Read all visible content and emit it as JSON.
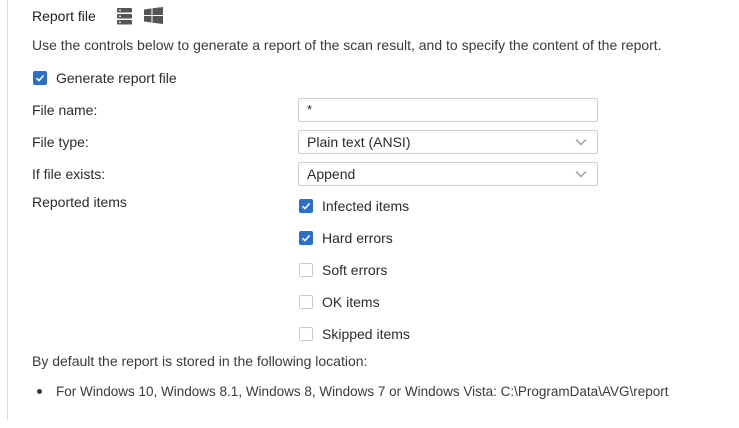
{
  "section": {
    "title": "Report file",
    "description": "Use the controls below to generate a report of the scan result, and to specify the content of the report."
  },
  "generate_report": {
    "label": "Generate report file",
    "checked": true
  },
  "fields": {
    "file_name": {
      "label": "File name:",
      "value": "*"
    },
    "file_type": {
      "label": "File type:",
      "value": "Plain text (ANSI)"
    },
    "if_file_exists": {
      "label": "If file exists:",
      "value": "Append"
    }
  },
  "reported_items": {
    "label": "Reported items",
    "items": [
      {
        "label": "Infected items",
        "checked": true
      },
      {
        "label": "Hard errors",
        "checked": true
      },
      {
        "label": "Soft errors",
        "checked": false
      },
      {
        "label": "OK items",
        "checked": false
      },
      {
        "label": "Skipped items",
        "checked": false
      }
    ]
  },
  "footer": {
    "intro": "By default the report is stored in the following location:",
    "locations": [
      "For Windows 10, Windows 8.1, Windows 8, Windows 7 or Windows Vista: C:\\ProgramData\\AVG\\report"
    ]
  },
  "colors": {
    "accent": "#2a6fcb",
    "border": "#cfcfcf"
  },
  "icons": {
    "server": "server-stack-icon",
    "windows": "windows-logo-icon"
  }
}
